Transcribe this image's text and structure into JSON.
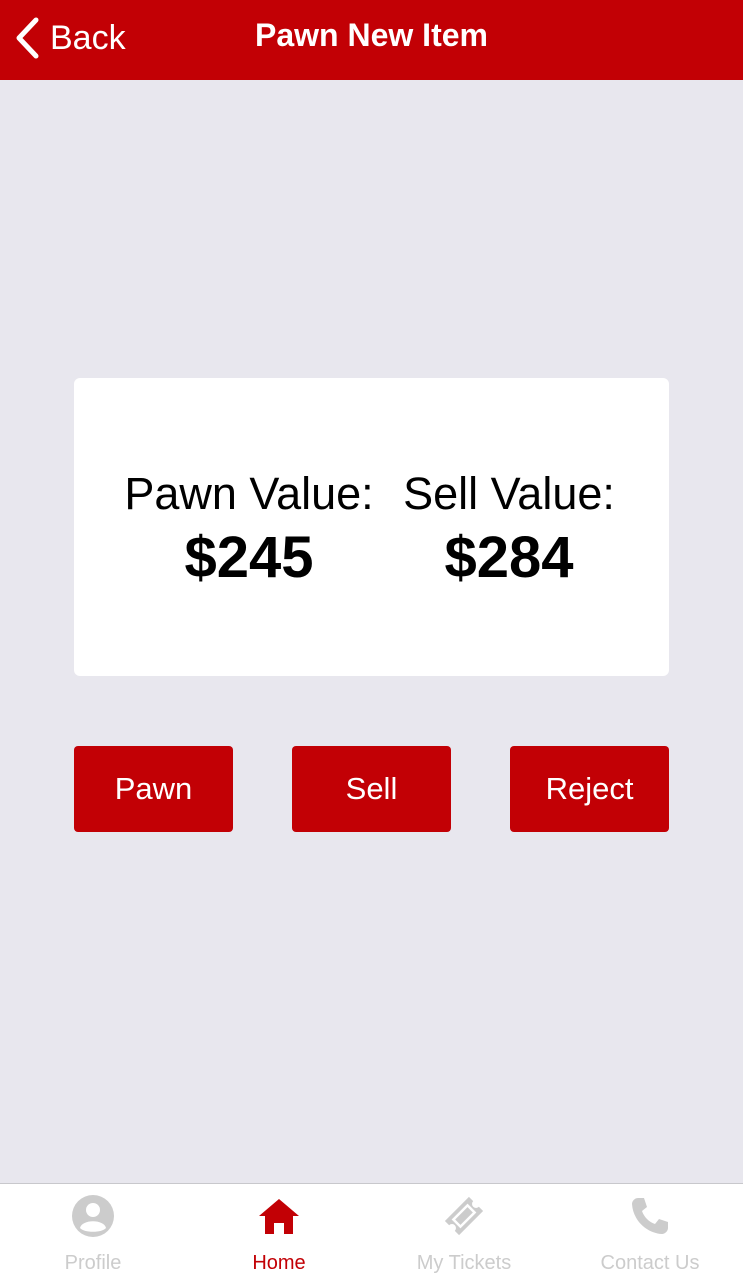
{
  "navbar": {
    "back_label": "Back",
    "title": "Pawn New Item"
  },
  "values": {
    "pawn_label": "Pawn Value:",
    "pawn_amount": "$245",
    "sell_label": "Sell Value:",
    "sell_amount": "$284"
  },
  "actions": {
    "pawn": "Pawn",
    "sell": "Sell",
    "reject": "Reject"
  },
  "tabbar": {
    "items": [
      {
        "label": "Profile",
        "icon": "profile-icon",
        "active": false
      },
      {
        "label": "Home",
        "icon": "home-icon",
        "active": true
      },
      {
        "label": "My Tickets",
        "icon": "ticket-icon",
        "active": false
      },
      {
        "label": "Contact Us",
        "icon": "phone-icon",
        "active": false
      }
    ]
  },
  "colors": {
    "brand_red": "#c20005",
    "background": "#e8e7ee",
    "inactive_tab": "#cccccc"
  }
}
